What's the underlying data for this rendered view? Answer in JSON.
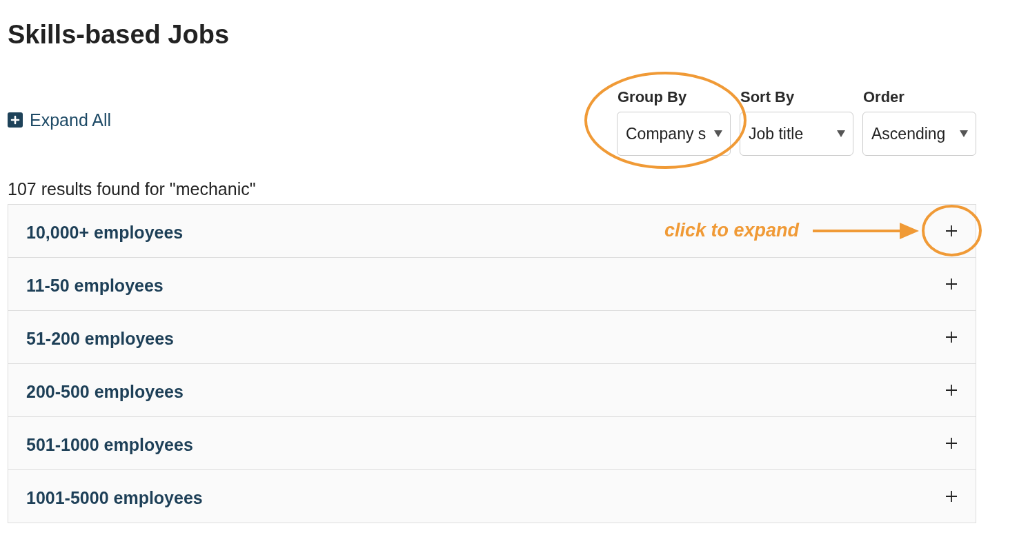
{
  "page_title": "Skills-based Jobs",
  "expand_all": {
    "label": "Expand All"
  },
  "filters": [
    {
      "label": "Group By",
      "value": "Company s",
      "highlighted": true
    },
    {
      "label": "Sort By",
      "value": "Job title",
      "highlighted": false
    },
    {
      "label": "Order",
      "value": "Ascending",
      "highlighted": false
    }
  ],
  "results_summary": "107 results found for \"mechanic\"",
  "groups": [
    {
      "label": "10,000+ employees",
      "expanded": false,
      "highlighted": true,
      "callout": "click to expand"
    },
    {
      "label": "11-50 employees",
      "expanded": false,
      "highlighted": false
    },
    {
      "label": "51-200 employees",
      "expanded": false,
      "highlighted": false
    },
    {
      "label": "200-500 employees",
      "expanded": false,
      "highlighted": false
    },
    {
      "label": "501-1000 employees",
      "expanded": false,
      "highlighted": false
    },
    {
      "label": "1001-5000 employees",
      "expanded": false,
      "highlighted": false
    }
  ]
}
